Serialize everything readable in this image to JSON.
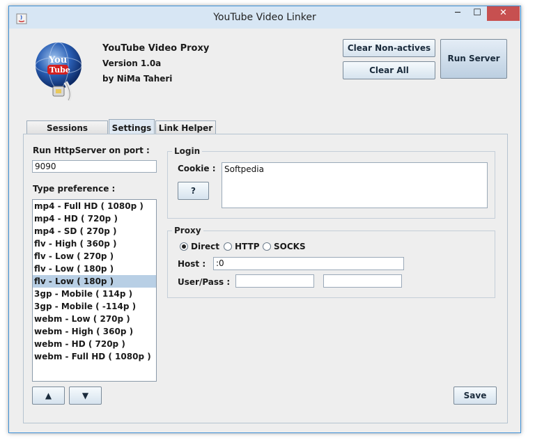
{
  "window": {
    "title": "YouTube Video Linker",
    "min_glyph": "─",
    "max_glyph": "☐",
    "close_glyph": "✕"
  },
  "header": {
    "app_name": "YouTube Video Proxy",
    "version": "Version 1.0a",
    "author": "by NiMa Taheri",
    "logo_text_top": "You",
    "logo_text_bottom": "Tube"
  },
  "toolbar": {
    "clear_non_actives": "Clear Non-actives",
    "clear_all": "Clear All",
    "run_server": "Run Server"
  },
  "tabs": [
    {
      "label": "Sessions Monitor"
    },
    {
      "label": "Settings"
    },
    {
      "label": "Link Helper"
    }
  ],
  "settings": {
    "port_label": "Run HttpServer on port :",
    "port_value": "9090",
    "type_pref_label": "Type preference :",
    "type_preferences": [
      "mp4 - Full HD ( 1080p )",
      "mp4 - HD ( 720p )",
      "mp4 - SD ( 270p )",
      "flv - High ( 360p )",
      "flv - Low ( 270p )",
      "flv - Low ( 180p )",
      "flv - Low ( 180p )",
      "3gp - Mobile ( 114p )",
      "3gp - Mobile ( -114p )",
      "webm - Low ( 270p )",
      "webm - High ( 360p )",
      "webm - HD ( 720p )",
      "webm - Full HD ( 1080p )"
    ],
    "selected_index": 6,
    "up_glyph": "▲",
    "down_glyph": "▼",
    "login": {
      "title": "Login",
      "cookie_label": "Cookie :",
      "cookie_value": "Softpedia",
      "help_button": "?"
    },
    "proxy": {
      "title": "Proxy",
      "options": [
        "Direct",
        "HTTP",
        "SOCKS"
      ],
      "selected": "Direct",
      "host_label": "Host :",
      "host_value": ":0",
      "userpass_label": "User/Pass :",
      "user_value": "",
      "pass_value": ""
    },
    "save_button": "Save"
  },
  "colors": {
    "accent": "#3c8fd6",
    "close": "#c75050",
    "selection": "#b8cfe5"
  }
}
